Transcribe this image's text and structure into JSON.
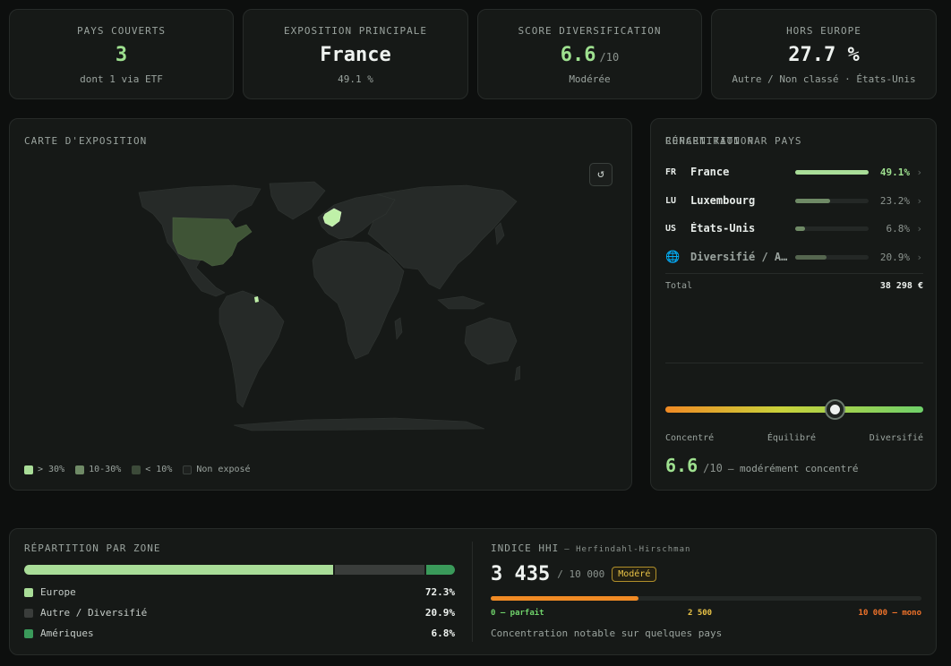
{
  "kpis": [
    {
      "label": "PAYS COUVERTS",
      "value": "3",
      "unit": "",
      "sub": "dont 1 via ETF"
    },
    {
      "label": "EXPOSITION PRINCIPALE",
      "value": "France",
      "unit": "",
      "sub": "49.1 %"
    },
    {
      "label": "SCORE DIVERSIFICATION",
      "value": "6.6",
      "unit": "/10",
      "sub": "Modérée"
    },
    {
      "label": "HORS EUROPE",
      "value": "27.7 %",
      "unit": "",
      "sub": "Autre / Non classé · États-Unis"
    }
  ],
  "map": {
    "title": "CARTE D'EXPOSITION",
    "reset_icon": "reset-icon",
    "legend": [
      {
        "label": "> 30%",
        "color": "#a9dd98"
      },
      {
        "label": "10-30%",
        "color": "#6f8a66"
      },
      {
        "label": "< 10%",
        "color": "#3c4a39"
      },
      {
        "label": "Non exposé",
        "color": "#1e211f"
      }
    ],
    "colors": {
      "land": "#262a28",
      "france": "#bff0a8",
      "usa": "#3f5436",
      "guiana": "#bff0a8"
    }
  },
  "countries": {
    "title": "RÉPARTITION PAR PAYS",
    "items": [
      {
        "code": "FR",
        "name": "France",
        "pct": "49.1%",
        "share": 0.491,
        "color": "#a9dd98",
        "highlight": true
      },
      {
        "code": "LU",
        "name": "Luxembourg",
        "pct": "23.2%",
        "share": 0.232,
        "color": "#6f8a66",
        "highlight": false
      },
      {
        "code": "US",
        "name": "États-Unis",
        "pct": "6.8%",
        "share": 0.068,
        "color": "#6f8a66",
        "highlight": false
      },
      {
        "code": "",
        "icon": "globe-icon",
        "name": "Diversifié / A…",
        "pct": "20.9%",
        "share": 0.209,
        "color": "#55664f",
        "highlight": false
      }
    ],
    "total_label": "Total",
    "total_value": "38 298 €"
  },
  "concentration": {
    "title": "CONCENTRATION",
    "position": 0.655,
    "labels": [
      "Concentré",
      "Équilibré",
      "Diversifié"
    ],
    "score": "6.6",
    "unit": "/10",
    "desc": "— modérément concentré"
  },
  "zones": {
    "title": "RÉPARTITION PAR ZONE",
    "items": [
      {
        "name": "Europe",
        "pct": "72.3%",
        "share": 0.723,
        "color": "#a9dd98"
      },
      {
        "name": "Autre / Diversifié",
        "pct": "20.9%",
        "share": 0.209,
        "color": "#3a3d3b"
      },
      {
        "name": "Amériques",
        "pct": "6.8%",
        "share": 0.068,
        "color": "#3a9a5a"
      }
    ]
  },
  "hhi": {
    "title": "INDICE HHI",
    "subtitle": "— Herfindahl-Hirschman",
    "value": "3 435",
    "max": "/ 10 000",
    "badge": "Modéré",
    "share": 0.3435,
    "scale": [
      {
        "label": "0 — parfait",
        "color": "#6fd16a"
      },
      {
        "label": "2 500",
        "color": "#e9c347"
      },
      {
        "label": "10 000 — mono",
        "color": "#f0732a"
      }
    ],
    "note": "Concentration notable sur quelques pays"
  }
}
